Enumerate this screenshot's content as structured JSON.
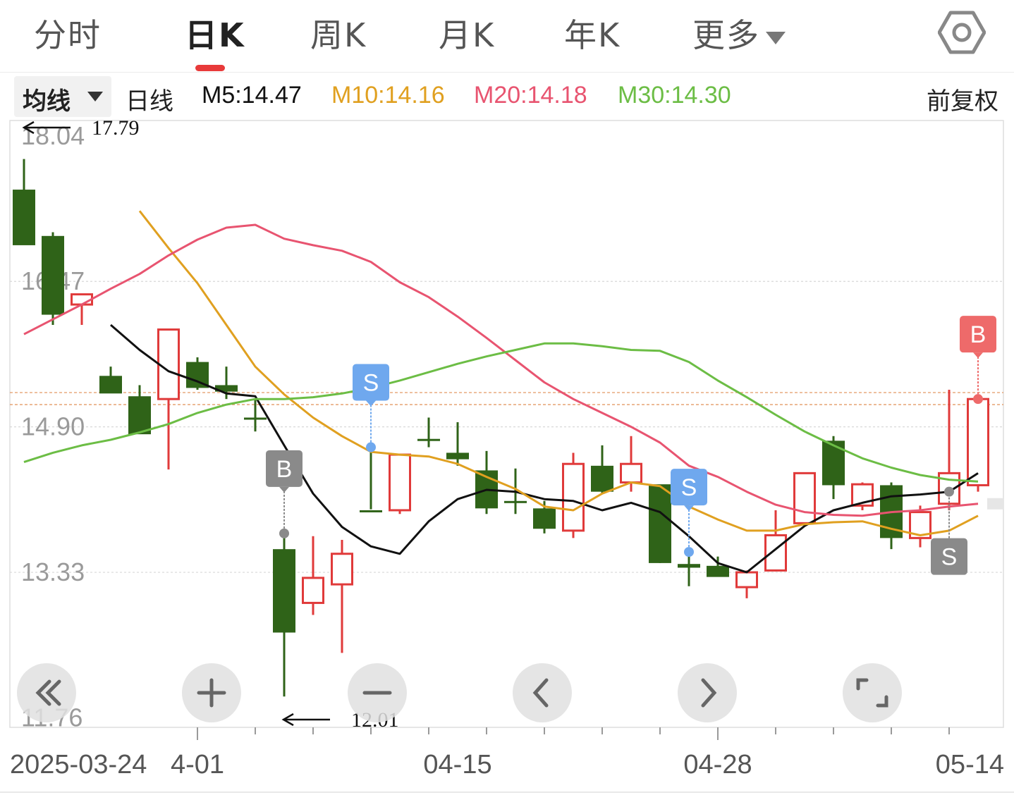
{
  "tabs": [
    {
      "label": "分时",
      "active": false
    },
    {
      "label": "日K",
      "active": true
    },
    {
      "label": "周K",
      "active": false
    },
    {
      "label": "月K",
      "active": false
    },
    {
      "label": "年K",
      "active": false
    },
    {
      "label": "更多",
      "active": false
    }
  ],
  "ma_bar": {
    "selector_label": "均线",
    "period_label": "日线",
    "ma5": "M5:14.47",
    "ma10": "M10:14.16",
    "ma20": "M20:14.18",
    "ma30": "M30:14.30",
    "adjust_label": "前复权"
  },
  "colors": {
    "up": "#e03a3a",
    "down": "#2f6318",
    "ma5": "#111111",
    "ma10": "#e0a020",
    "ma20": "#e85470",
    "ma30": "#6cbd45",
    "sell_marker": "#6fa8ee",
    "marker_gray": "#8a8a8a",
    "buy_marker_red": "#ee6a6a"
  },
  "icons": {
    "settings": "gear-icon",
    "more": "caret-down-icon",
    "first": "double-chevron-left-icon",
    "zoom_in": "plus-icon",
    "zoom_out": "minus-icon",
    "prev": "chevron-left-icon",
    "next": "chevron-right-icon",
    "fullscreen": "fullscreen-icon"
  },
  "chart_data": {
    "type": "candlestick",
    "ylim": [
      11.76,
      18.04
    ],
    "y_ticks": [
      "18.04",
      "16.47",
      "14.90",
      "13.33",
      "11.76"
    ],
    "x_labels": [
      {
        "label": "2025-03-24",
        "index": 0
      },
      {
        "label": "4-01",
        "index": 6
      },
      {
        "label": "04-15",
        "index": 15
      },
      {
        "label": "04-28",
        "index": 24
      },
      {
        "label": "05-14",
        "index": 33
      }
    ],
    "high_annotation": {
      "label": "17.79",
      "index": 0,
      "price": 17.79
    },
    "low_annotation": {
      "label": "12.01",
      "index": 9,
      "price": 12.01
    },
    "candles": [
      {
        "o": 17.46,
        "h": 17.79,
        "l": 16.9,
        "c": 16.86
      },
      {
        "o": 16.96,
        "h": 17.0,
        "l": 16.0,
        "c": 16.11
      },
      {
        "o": 16.22,
        "h": 16.33,
        "l": 16.0,
        "c": 16.33
      },
      {
        "o": 15.45,
        "h": 15.55,
        "l": 15.3,
        "c": 15.26
      },
      {
        "o": 15.23,
        "h": 15.35,
        "l": 15.0,
        "c": 14.82
      },
      {
        "o": 15.2,
        "h": 15.82,
        "l": 14.44,
        "c": 15.95
      },
      {
        "o": 15.6,
        "h": 15.65,
        "l": 15.3,
        "c": 15.32
      },
      {
        "o": 15.35,
        "h": 15.55,
        "l": 15.2,
        "c": 15.28
      },
      {
        "o": 15.0,
        "h": 15.2,
        "l": 14.85,
        "c": 15.0
      },
      {
        "o": 13.58,
        "h": 13.75,
        "l": 11.99,
        "c": 12.68
      },
      {
        "o": 13.0,
        "h": 13.72,
        "l": 12.87,
        "c": 13.27
      },
      {
        "o": 13.2,
        "h": 13.68,
        "l": 12.46,
        "c": 13.53
      },
      {
        "o": 14.0,
        "h": 14.68,
        "l": 14.01,
        "c": 14.0
      },
      {
        "o": 14.0,
        "h": 14.52,
        "l": 13.96,
        "c": 14.6
      },
      {
        "o": 14.77,
        "h": 15.0,
        "l": 14.68,
        "c": 14.77
      },
      {
        "o": 14.62,
        "h": 14.95,
        "l": 14.48,
        "c": 14.55
      },
      {
        "o": 14.43,
        "h": 14.64,
        "l": 13.96,
        "c": 14.02
      },
      {
        "o": 14.1,
        "h": 14.45,
        "l": 13.96,
        "c": 14.1
      },
      {
        "o": 14.02,
        "h": 14.1,
        "l": 13.75,
        "c": 13.8
      },
      {
        "o": 13.78,
        "h": 14.62,
        "l": 13.7,
        "c": 14.5
      },
      {
        "o": 14.48,
        "h": 14.7,
        "l": 14.18,
        "c": 14.2
      },
      {
        "o": 14.3,
        "h": 14.8,
        "l": 14.2,
        "c": 14.5
      },
      {
        "o": 14.28,
        "h": 14.2,
        "l": 13.43,
        "c": 13.43
      },
      {
        "o": 13.42,
        "h": 13.55,
        "l": 13.18,
        "c": 13.38
      },
      {
        "o": 13.4,
        "h": 13.5,
        "l": 13.3,
        "c": 13.28
      },
      {
        "o": 13.17,
        "h": 13.35,
        "l": 13.05,
        "c": 13.33
      },
      {
        "o": 13.35,
        "h": 14.0,
        "l": 13.34,
        "c": 13.73
      },
      {
        "o": 13.86,
        "h": 14.0,
        "l": 13.85,
        "c": 14.4
      },
      {
        "o": 14.75,
        "h": 14.8,
        "l": 14.12,
        "c": 14.27
      },
      {
        "o": 14.05,
        "h": 14.3,
        "l": 14.0,
        "c": 14.28
      },
      {
        "o": 14.27,
        "h": 14.3,
        "l": 13.58,
        "c": 13.7
      },
      {
        "o": 13.7,
        "h": 14.05,
        "l": 13.6,
        "c": 13.98
      },
      {
        "o": 14.07,
        "h": 15.3,
        "l": 14.0,
        "c": 14.4
      },
      {
        "o": 14.27,
        "h": 15.2,
        "l": 14.2,
        "c": 15.2
      }
    ],
    "series": [
      {
        "name": "M5",
        "values": [
          null,
          null,
          null,
          16.0,
          15.73,
          15.5,
          15.39,
          15.26,
          15.23,
          14.7,
          14.18,
          13.82,
          13.61,
          13.53,
          13.88,
          14.12,
          14.22,
          14.2,
          14.12,
          14.1,
          14.0,
          14.08,
          13.98,
          13.72,
          13.43,
          13.33,
          13.58,
          13.83,
          14.0,
          14.08,
          14.15,
          14.17,
          14.2,
          14.4
        ]
      },
      {
        "name": "M10",
        "values": [
          null,
          null,
          null,
          null,
          17.23,
          16.83,
          16.45,
          16.0,
          15.55,
          15.25,
          15.0,
          14.8,
          14.63,
          14.6,
          14.58,
          14.5,
          14.36,
          14.23,
          14.04,
          14.0,
          14.18,
          14.3,
          14.26,
          14.04,
          13.9,
          13.78,
          13.78,
          13.85,
          13.87,
          13.88,
          13.8,
          13.73,
          13.78,
          13.94
        ]
      },
      {
        "name": "M20",
        "values": [
          15.9,
          16.06,
          16.22,
          16.39,
          16.55,
          16.75,
          16.92,
          17.05,
          17.08,
          16.93,
          16.86,
          16.8,
          16.68,
          16.46,
          16.3,
          16.09,
          15.86,
          15.62,
          15.38,
          15.2,
          15.05,
          14.9,
          14.73,
          14.48,
          14.36,
          14.2,
          14.06,
          13.98,
          13.95,
          13.94,
          13.98,
          14.0,
          14.04,
          14.07
        ]
      },
      {
        "name": "M30",
        "values": [
          14.52,
          14.62,
          14.7,
          14.76,
          14.84,
          14.93,
          15.05,
          15.14,
          15.2,
          15.2,
          15.22,
          15.26,
          15.32,
          15.4,
          15.49,
          15.58,
          15.66,
          15.73,
          15.8,
          15.8,
          15.77,
          15.73,
          15.72,
          15.6,
          15.4,
          15.22,
          15.03,
          14.85,
          14.7,
          14.56,
          14.46,
          14.38,
          14.33,
          14.31
        ]
      }
    ],
    "markers": [
      {
        "label": "B",
        "index": 9,
        "price": 13.75,
        "position": "above",
        "color": "gray"
      },
      {
        "label": "S",
        "index": 12,
        "price": 14.68,
        "position": "above",
        "color": "blue"
      },
      {
        "label": "S",
        "index": 23,
        "price": 13.55,
        "position": "above",
        "color": "blue"
      },
      {
        "label": "S",
        "index": 32,
        "price": 14.2,
        "position": "below",
        "color": "gray"
      },
      {
        "label": "B",
        "index": 33,
        "price": 15.2,
        "position": "above",
        "color": "red"
      }
    ],
    "reference_lines": [
      15.27,
      15.14
    ],
    "last_price_tag": 14.07,
    "grid": true
  }
}
